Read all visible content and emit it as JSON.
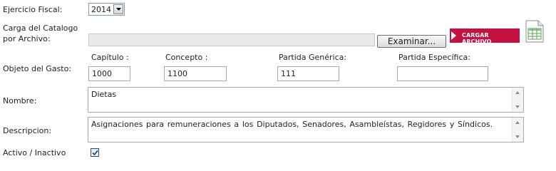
{
  "form": {
    "ejercicio": {
      "label": "Ejercicio Fiscal:",
      "value": "2014"
    },
    "carga": {
      "label_line1": "Carga del Catalogo",
      "label_line2": "por Archivo:",
      "browse_label": "Examinar...",
      "upload_label": "CARGAR ARCHIVO",
      "file_icon": "spreadsheet-icon"
    },
    "objeto": {
      "label": "Objeto del Gasto:",
      "capitulo": {
        "label": "Capítulo :",
        "value": "1000"
      },
      "concepto": {
        "label": "Concepto :",
        "value": "1100"
      },
      "partida_generica": {
        "label": "Partida Genérica:",
        "value": "111"
      },
      "partida_especifica": {
        "label": "Partida Específica:",
        "value": ""
      }
    },
    "nombre": {
      "label": "Nombre:",
      "value": "Dietas"
    },
    "descripcion": {
      "label": "Descripcion:",
      "value": "Asignaciones para remuneraciones a los Diputados, Senadores, Asambleístas, Regidores y Síndicos."
    },
    "activo": {
      "label": "Activo / Inactivo",
      "checked": true
    }
  },
  "colors": {
    "accent": "#c5113f",
    "check": "#1c5180"
  }
}
